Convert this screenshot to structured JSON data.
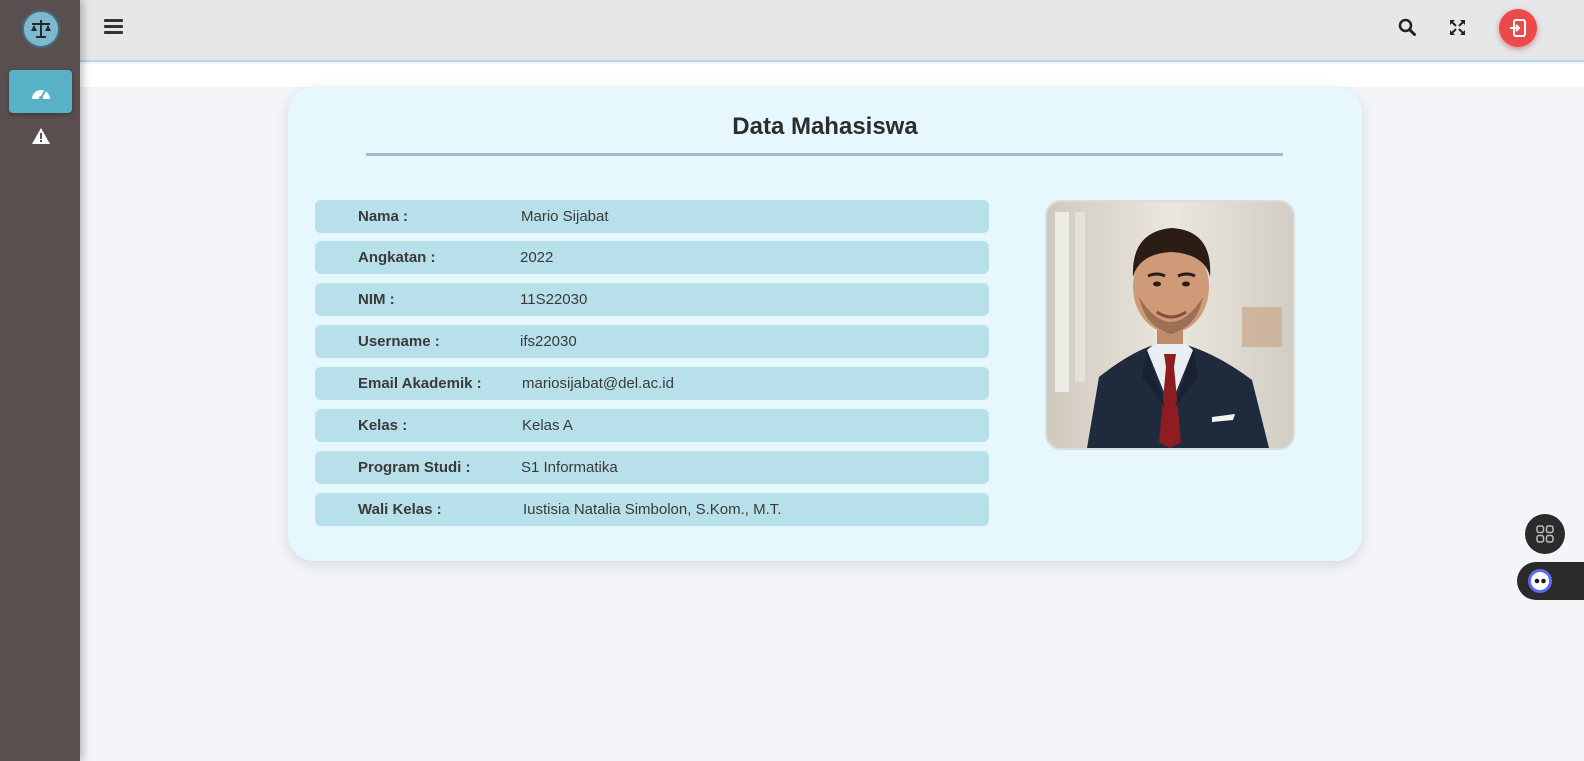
{
  "sidebar": {
    "logo": "scales-logo-icon",
    "items": [
      {
        "icon": "dashboard-gauge-icon",
        "active": true
      },
      {
        "icon": "warning-icon",
        "active": false
      }
    ]
  },
  "topbar": {
    "menu_icon": "hamburger-icon",
    "search_icon": "search-icon",
    "fullscreen_icon": "expand-icon",
    "logout_icon": "logout-icon"
  },
  "card": {
    "title": "Data Mahasiswa",
    "rows": [
      {
        "label": "Nama :",
        "value": "Mario Sijabat"
      },
      {
        "label": "Angkatan :",
        "value": "2022"
      },
      {
        "label": "NIM :",
        "value": "11S22030"
      },
      {
        "label": "Username :",
        "value": "ifs22030"
      },
      {
        "label": "Email Akademik :",
        "value": "mariosijabat@del.ac.id"
      },
      {
        "label": "Kelas :",
        "value": "Kelas A"
      },
      {
        "label": "Program Studi :",
        "value": "S1 Informatika"
      },
      {
        "label": "Wali Kelas :",
        "value": "Iustisia Natalia Simbolon, S.Kom., M.T."
      }
    ],
    "photo": "student-profile-photo"
  },
  "widgets": {
    "apps_icon": "apps-grid-icon",
    "assistant_icon": "assistant-bot-icon"
  },
  "colors": {
    "sidebar": "#5a4f4f",
    "active_nav": "#57b2c8",
    "card_bg": "#e6f8fd",
    "row_bg": "#b8e0ea",
    "logout": "#ea4a4a"
  }
}
